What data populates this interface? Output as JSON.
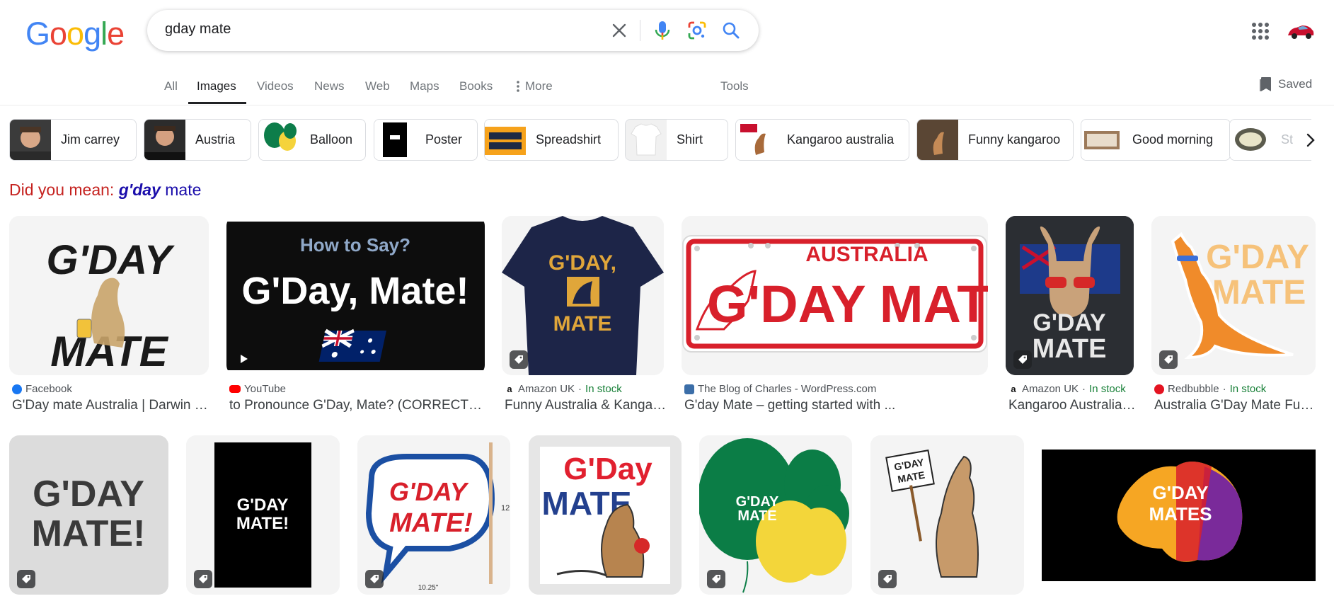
{
  "logo": {
    "letters": [
      "G",
      "o",
      "o",
      "g",
      "l",
      "e"
    ],
    "colors": [
      "#4285F4",
      "#EA4335",
      "#FBBC05",
      "#4285F4",
      "#34A853",
      "#EA4335"
    ]
  },
  "search": {
    "query": "gday mate"
  },
  "icons": {
    "clear": "close-icon",
    "voice": "microphone-icon",
    "lens": "camera-lens-icon",
    "search": "search-icon",
    "apps": "apps-grid-icon",
    "saved": "bookmark-icon"
  },
  "tabs": {
    "all": "All",
    "images": "Images",
    "videos": "Videos",
    "news": "News",
    "web": "Web",
    "maps": "Maps",
    "books": "Books",
    "more": "More",
    "tools": "Tools"
  },
  "saved_label": "Saved",
  "chips": [
    "Jim carrey",
    "Austria",
    "Balloon",
    "Poster",
    "Spreadshirt",
    "Shirt",
    "Kangaroo australia",
    "Funny kangaroo",
    "Good morning",
    "St"
  ],
  "did_you_mean": {
    "prefix": "Did you mean:",
    "bold": "g'day",
    "rest": "mate"
  },
  "results_row1": [
    {
      "source": "Facebook",
      "title": "G'Day mate Australia | Darwin NT",
      "stock": "",
      "img_text": [
        "G'DAY",
        "MATE"
      ]
    },
    {
      "source": "YouTube",
      "title": "to Pronounce G'Day, Mate? (CORRECTLY ...",
      "stock": "",
      "img_text": [
        "How to Say?",
        "G'Day, Mate!"
      ]
    },
    {
      "source": "Amazon UK",
      "title": "Funny Australia & Kangaroo ...",
      "stock": "In stock",
      "img_text": [
        "G'DAY,",
        "MATE"
      ]
    },
    {
      "source": "The Blog of Charles - WordPress.com",
      "title": "G'day Mate – getting started with ...",
      "stock": "",
      "img_text": [
        "AUSTRALIA",
        "G'DAY MATE"
      ]
    },
    {
      "source": "Amazon UK",
      "title": "Kangaroo Australia ...",
      "stock": "In stock",
      "img_text": [
        "G'DAY",
        "MATE"
      ]
    },
    {
      "source": "Redbubble",
      "title": "Australia G'Day Mate Funny ...",
      "stock": "In stock",
      "img_text": [
        "G'DAY",
        "MATE"
      ]
    }
  ],
  "results_row2": [
    {
      "img_text": [
        "G'DAY",
        "MATE!"
      ]
    },
    {
      "img_text": [
        "G'DAY",
        "MATE!"
      ]
    },
    {
      "img_text": [
        "G'DAY",
        "MATE!",
        "12",
        "10.25\""
      ]
    },
    {
      "img_text": [
        "G'Day",
        "MATE"
      ]
    },
    {
      "img_text": [
        "G'DAY",
        "MATE"
      ]
    },
    {
      "img_text": [
        "G'DAY",
        "MATE"
      ]
    },
    {
      "img_text": [
        "G'DAY",
        "MATES"
      ]
    }
  ],
  "source_separator": "·"
}
